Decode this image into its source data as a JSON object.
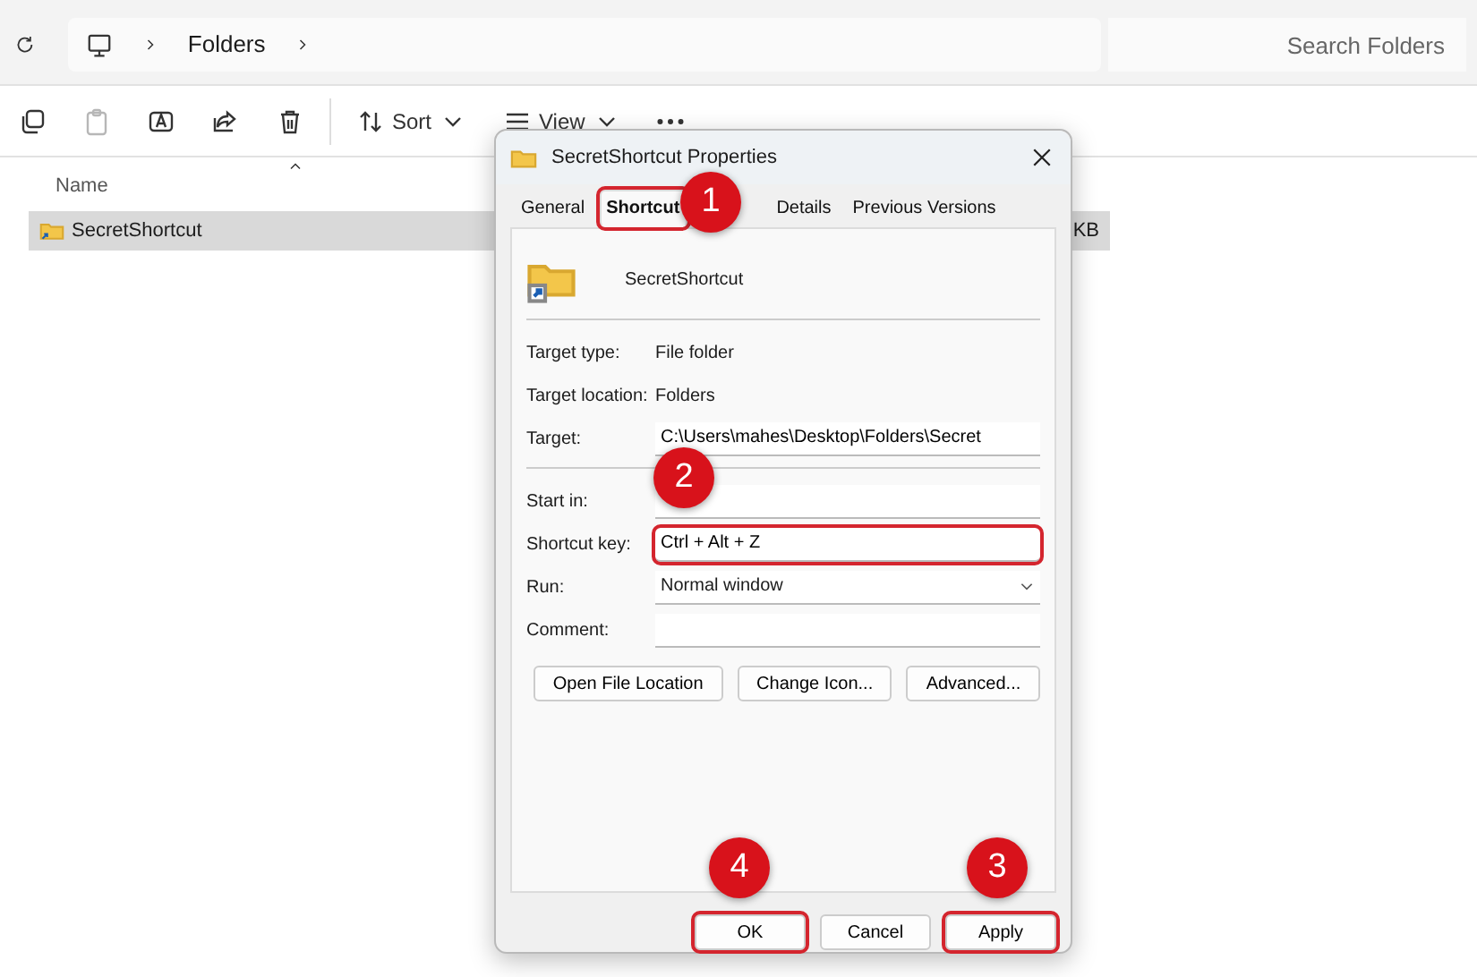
{
  "explorer": {
    "address": {
      "items": [
        "Folders"
      ]
    },
    "search": {
      "placeholder": "Search Folders"
    },
    "toolbar": [
      {
        "kind": "icon",
        "disabled": false
      },
      {
        "kind": "icon",
        "disabled": true
      },
      {
        "kind": "icon",
        "disabled": false
      },
      {
        "kind": "icon",
        "disabled": false
      },
      {
        "kind": "icon",
        "disabled": false
      },
      {
        "kind": "menu",
        "label": "Sort"
      },
      {
        "kind": "menu",
        "label": "View"
      },
      {
        "kind": "more"
      }
    ],
    "columns": [
      "Name"
    ],
    "rows": [
      {
        "name": "SecretShortcut",
        "size": "KB",
        "selected": true
      }
    ]
  },
  "dialog": {
    "title": "SecretShortcut Properties",
    "tabs": [
      {
        "label": "General",
        "selected": false,
        "highlighted": false
      },
      {
        "label": "Shortcut",
        "selected": true,
        "highlighted": true
      },
      {
        "label": "Details",
        "selected": false,
        "highlighted": false
      },
      {
        "label": "Previous Versions",
        "selected": false,
        "highlighted": false
      }
    ],
    "name": "SecretShortcut",
    "groups": [
      [
        {
          "kind": "info",
          "label": "Target type:",
          "value": "File folder"
        },
        {
          "kind": "info",
          "label": "Target location:",
          "value": "Folders"
        },
        {
          "kind": "text",
          "label": "Target:",
          "value": "C:\\Users\\mahes\\Desktop\\Folders\\Secret",
          "highlighted": false
        }
      ],
      [
        {
          "kind": "text",
          "label": "Start in:",
          "highlighted": false
        },
        {
          "kind": "text",
          "label": "Shortcut key:",
          "value": "Ctrl + Alt + Z",
          "highlighted": true
        },
        {
          "kind": "select",
          "label": "Run:",
          "value": "Normal window",
          "highlighted": false
        },
        {
          "kind": "text",
          "label": "Comment:",
          "highlighted": false
        }
      ]
    ],
    "actions": [
      "Open File Location",
      "Change Icon...",
      "Advanced..."
    ],
    "footer": [
      {
        "label": "OK",
        "highlighted": true
      },
      {
        "label": "Cancel",
        "highlighted": false
      },
      {
        "label": "Apply",
        "highlighted": true
      }
    ]
  },
  "callouts": [
    "1",
    "2",
    "3",
    "4"
  ]
}
